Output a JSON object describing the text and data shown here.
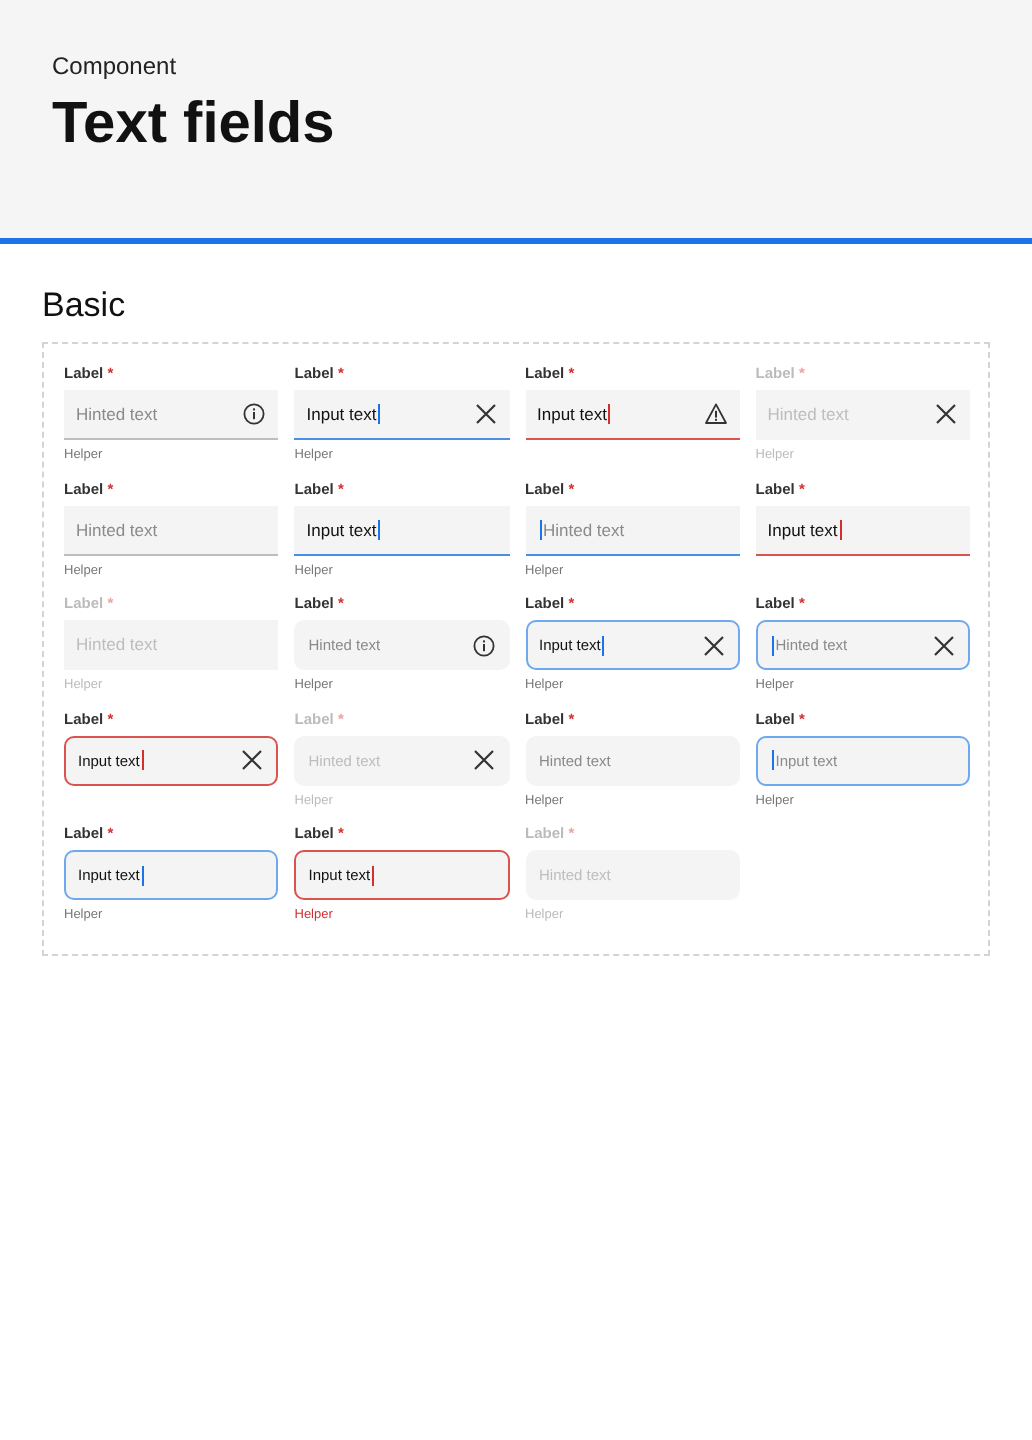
{
  "header": {
    "eyebrow": "Component",
    "title": "Text fields"
  },
  "section": {
    "title": "Basic"
  },
  "fields": [
    {
      "kind": "underline",
      "focused": false,
      "error": false,
      "disabled": false,
      "label": "Label",
      "required": "*",
      "placeholder": "Hinted text",
      "trailing": {
        "kind": "info"
      },
      "cursor": false,
      "helper": "Helper"
    },
    {
      "kind": "underline",
      "focused": true,
      "error": false,
      "disabled": false,
      "label": "Label",
      "required": "*",
      "value": "Input text",
      "trailing": {
        "kind": "clear"
      },
      "cursor": true,
      "helper": "Helper"
    },
    {
      "kind": "underline",
      "focused": false,
      "error": true,
      "disabled": false,
      "label": "Label",
      "required": "*",
      "value": "Input text",
      "trailing": {
        "kind": "warning"
      },
      "cursor": true
    },
    {
      "kind": "underline",
      "focused": false,
      "error": false,
      "disabled": true,
      "label": "Label",
      "required": "*",
      "placeholder": "Hinted text",
      "trailing": {
        "kind": "clear"
      },
      "cursor": false,
      "helper": "Helper"
    },
    {
      "kind": "underline",
      "focused": false,
      "error": false,
      "disabled": false,
      "label": "Label",
      "required": "*",
      "placeholder": "Hinted text",
      "cursor": false,
      "helper": "Helper"
    },
    {
      "kind": "underline",
      "focused": true,
      "error": false,
      "disabled": false,
      "label": "Label",
      "required": "*",
      "value": "Input text",
      "cursor": true,
      "helper": "Helper"
    },
    {
      "kind": "underline",
      "focused": true,
      "error": false,
      "disabled": false,
      "label": "Label",
      "required": "*",
      "placeholder": "Hinted text",
      "cursor": true,
      "helper": "Helper"
    },
    {
      "kind": "underline",
      "focused": false,
      "error": true,
      "disabled": false,
      "label": "Label",
      "required": "*",
      "value": "Input text",
      "cursor": true
    },
    {
      "kind": "underline",
      "focused": false,
      "error": false,
      "disabled": true,
      "label": "Label",
      "required": "*",
      "placeholder": "Hinted text",
      "cursor": false,
      "helper": "Helper"
    },
    {
      "kind": "rounded",
      "focused": false,
      "error": false,
      "disabled": false,
      "label": "Label",
      "required": "*",
      "placeholder": "Hinted text",
      "trailing": {
        "kind": "info"
      },
      "cursor": false,
      "helper": "Helper"
    },
    {
      "kind": "rounded",
      "focused": true,
      "error": false,
      "disabled": false,
      "label": "Label",
      "required": "*",
      "value": "Input text",
      "trailing": {
        "kind": "clear"
      },
      "cursor": true,
      "helper": "Helper"
    },
    {
      "kind": "rounded",
      "focused": true,
      "error": false,
      "disabled": false,
      "label": "Label",
      "required": "*",
      "placeholder": "Hinted text",
      "trailing": {
        "kind": "clear"
      },
      "cursor": true,
      "helper": "Helper"
    },
    {
      "kind": "rounded",
      "focused": false,
      "error": true,
      "disabled": false,
      "label": "Label",
      "required": "*",
      "value": "Input text",
      "trailing": {
        "kind": "clear"
      },
      "cursor": true
    },
    {
      "kind": "rounded",
      "focused": false,
      "error": false,
      "disabled": true,
      "label": "Label",
      "required": "*",
      "placeholder": "Hinted text",
      "trailing": {
        "kind": "clear"
      },
      "cursor": false,
      "helper": "Helper"
    },
    {
      "kind": "rounded",
      "focused": false,
      "error": false,
      "disabled": false,
      "label": "Label",
      "required": "*",
      "placeholder": "Hinted text",
      "cursor": false,
      "helper": "Helper"
    },
    {
      "kind": "rounded",
      "focused": true,
      "error": false,
      "disabled": false,
      "label": "Label",
      "required": "*",
      "placeholder": "Input text",
      "cursor": true,
      "helper": "Helper"
    },
    {
      "kind": "rounded",
      "focused": true,
      "error": false,
      "disabled": false,
      "label": "Label",
      "required": "*",
      "value": "Input text",
      "cursor": true,
      "helper": "Helper"
    },
    {
      "kind": "rounded",
      "focused": false,
      "error": true,
      "disabled": false,
      "label": "Label",
      "required": "*",
      "value": "Input text",
      "cursor": true,
      "helper": "Helper"
    },
    {
      "kind": "rounded",
      "focused": false,
      "error": false,
      "disabled": true,
      "label": "Label",
      "required": "*",
      "placeholder": "Hinted text",
      "cursor": false,
      "helper": "Helper"
    }
  ]
}
